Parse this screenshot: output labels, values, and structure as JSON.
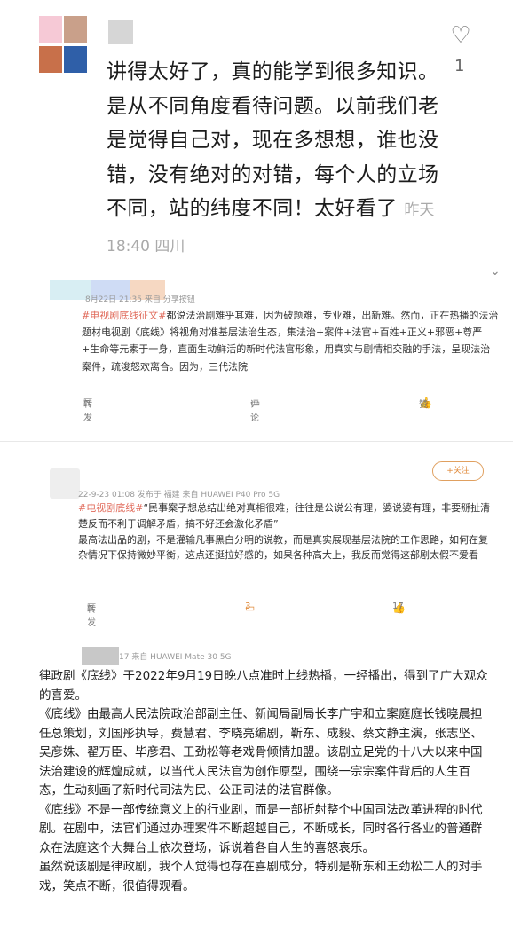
{
  "card1": {
    "like_count": "1",
    "text": "讲得太好了，真的能学到很多知识。是从不同角度看待问题。以前我们老是觉得自己对，现在多想想，谁也没错，没有绝对的对错，每个人的立场不同，站的纬度不同！太好看了",
    "meta": "昨天 18:40 四川",
    "colors": {
      "accent": "#1c1c1c"
    }
  },
  "card2": {
    "meta": "8月22日 21:35 来自 分享按钮",
    "tag": "#电视剧底线征文#",
    "body": "都说法治剧难乎其难，因为破题难，专业难，出新难。然而，正在热播的法治题材电视剧《底线》将视角对准基层法治生态，集法治+案件+法官+百姓+正义+邪恶+尊严+生命等元素于一身，直面生动鲜活的新时代法官形象，用真实与剧情相交融的手法，呈现法治案件，疏浚怒欢离合。因为，三代法院",
    "actions": {
      "forward": "转发",
      "comment": "评论",
      "like": "赞"
    }
  },
  "card3": {
    "follow": "+关注",
    "meta": "22-9-23 01:08 发布于 福建 来自 HUAWEI P40 Pro 5G",
    "tag": "#电视剧底线#",
    "quote": "“民事案子想总结出绝对真相很难，往往是公说公有理，婆说婆有理，非要掰扯清楚反而不利于调解矛盾，搞不好还会激化矛盾”",
    "body": "最高法出品的剧，不是灌输凡事黑白分明的说教，而是真实展现基层法院的工作思路，如何在复杂情况下保持微妙平衡，这点还挺拉好感的，如果各种高大上，我反而觉得这部剧太假不爱看",
    "actions": {
      "forward": "转发",
      "comment": "3",
      "like": "17"
    }
  },
  "card4": {
    "meta": "17 来自 HUAWEI Mate 30 5G",
    "paragraphs": [
      "律政剧《底线》于2022年9月19日晚八点准时上线热播，一经播出，得到了广大观众的喜爱。",
      "《底线》由最高人民法院政治部副主任、新闻局副局长李广宇和立案庭庭长钱晓晨担任总策划，刘国彤执导，费慧君、李晓亮编剧，靳东、成毅、蔡文静主演，张志坚、吴彦姝、翟万臣、毕彦君、王劲松等老戏骨倾情加盟。该剧立足党的十八大以来中国法治建设的辉煌成就，以当代人民法官为创作原型，围绕一宗宗案件背后的人生百态，生动刻画了新时代司法为民、公正司法的法官群像。",
      "《底线》不是一部传统意义上的行业剧，而是一部折射整个中国司法改革进程的时代剧。在剧中，法官们通过办理案件不断超越自己，不断成长，同时各行各业的普通群众在法庭这个大舞台上依次登场，诉说着各自人生的喜怒哀乐。",
      "虽然说该剧是律政剧，我个人觉得也存在喜剧成分，特别是靳东和王劲松二人的对手戏，笑点不断，很值得观看。"
    ]
  }
}
